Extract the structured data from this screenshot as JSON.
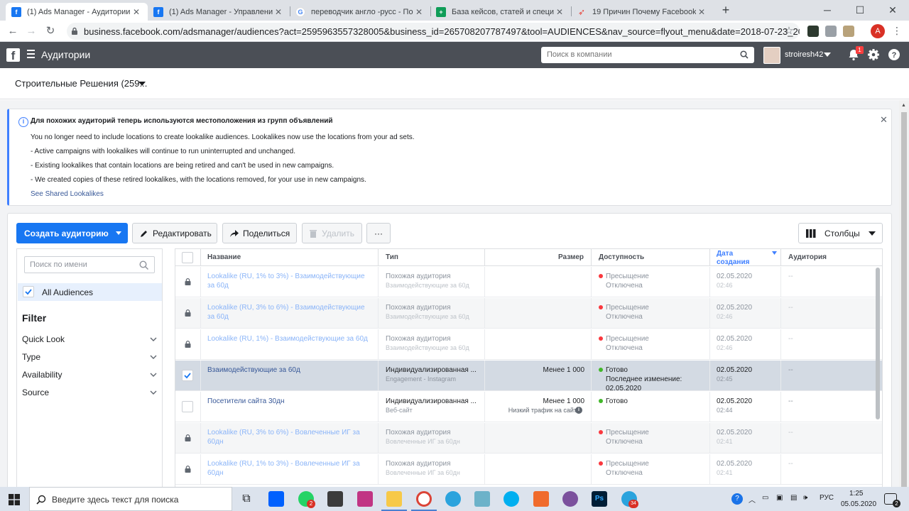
{
  "browser": {
    "tabs": [
      {
        "title": "(1) Ads Manager - Аудитории",
        "active": true
      },
      {
        "title": "(1) Ads Manager - Управление р",
        "active": false
      },
      {
        "title": "переводчик англо -русс - Поис",
        "active": false
      },
      {
        "title": "База кейсов, статей и специали",
        "active": false
      },
      {
        "title": "19 Причин Почему Facebook За",
        "active": false
      }
    ],
    "url": "business.facebook.com/adsmanager/audiences?act=2595963557328005&business_id=265708207787497&tool=AUDIENCES&nav_source=flyout_menu&date=2018-07-23_2020-05-03%2C...",
    "profile_initial": "A"
  },
  "fb": {
    "title": "Аудитории",
    "search_placeholder": "Поиск в компании",
    "username": "stroiresh42",
    "notif_count": "1"
  },
  "account": {
    "name": "Строительные Решения (259..."
  },
  "notice": {
    "title": "Для похожих аудиторий теперь используются местоположения из групп объявлений",
    "lines": [
      "You no longer need to include locations to create lookalike audiences. Lookalikes now use the locations from your ad sets.",
      "- Active campaigns with lookalikes will continue to run uninterrupted and unchanged.",
      "- Existing lookalikes that contain locations are being retired and can't be used in new campaigns.",
      "- We created copies of these retired lookalikes, with the locations removed, for your use in new campaigns."
    ],
    "link": "See Shared Lookalikes"
  },
  "toolbar": {
    "create": "Создать аудиторию",
    "edit": "Редактировать",
    "share": "Поделиться",
    "delete": "Удалить",
    "more": "···",
    "columns": "Столбцы"
  },
  "filter": {
    "search_placeholder": "Поиск по имени",
    "all": "All Audiences",
    "heading": "Filter",
    "items": [
      "Quick Look",
      "Type",
      "Availability",
      "Source"
    ]
  },
  "table": {
    "headers": {
      "name": "Название",
      "type": "Тип",
      "size": "Размер",
      "availability": "Доступность",
      "date": "Дата создания",
      "audience": "Аудитория"
    },
    "rows": [
      {
        "name": "Lookalike (RU, 1% to 3%) - Взаимодействующие за 60д",
        "type": "Похожая аудитория",
        "subtype": "Взаимодействующие за 60д",
        "size": "",
        "size_note": "",
        "status": "Пресыщение",
        "status2": "Отключена",
        "status_color": "#fa383e",
        "date": "02.05.2020",
        "time": "02:46",
        "audience": "--",
        "kind": "locked"
      },
      {
        "name": "Lookalike (RU, 3% to 6%) - Взаимодействующие за 60д",
        "type": "Похожая аудитория",
        "subtype": "Взаимодействующие за 60д",
        "size": "",
        "size_note": "",
        "status": "Пресыщение",
        "status2": "Отключена",
        "status_color": "#fa383e",
        "date": "02.05.2020",
        "time": "02:46",
        "audience": "--",
        "kind": "locked"
      },
      {
        "name": "Lookalike (RU, 1%) - Взаимодействующие за 60д",
        "type": "Похожая аудитория",
        "subtype": "Взаимодействующие за 60д",
        "size": "",
        "size_note": "",
        "status": "Пресыщение",
        "status2": "Отключена",
        "status_color": "#fa383e",
        "date": "02.05.2020",
        "time": "02:46",
        "audience": "--",
        "kind": "locked"
      },
      {
        "name": "Взаимодействующие за 60д",
        "type": "Индивидуализированная ...",
        "subtype": "Engagement - Instagram",
        "size": "Менее 1 000",
        "size_note": "",
        "status": "Готово",
        "status2": "Последнее изменение: 02.05.2020",
        "status_color": "#42b72a",
        "date": "02.05.2020",
        "time": "02:45",
        "audience": "--",
        "kind": "selected"
      },
      {
        "name": "Посетители сайта 30дн",
        "type": "Индивидуализированная ...",
        "subtype": "Веб-сайт",
        "size": "Менее 1 000",
        "size_note": "Низкий трафик на сайт",
        "status": "Готово",
        "status2": "",
        "status_color": "#42b72a",
        "date": "02.05.2020",
        "time": "02:44",
        "audience": "--",
        "kind": "normal"
      },
      {
        "name": "Lookalike (RU, 3% to 6%) - Вовлеченные ИГ за 60дн",
        "type": "Похожая аудитория",
        "subtype": "Вовлеченные ИГ за 60дн",
        "size": "",
        "size_note": "",
        "status": "Пресыщение",
        "status2": "Отключена",
        "status_color": "#fa383e",
        "date": "02.05.2020",
        "time": "02:41",
        "audience": "--",
        "kind": "locked"
      },
      {
        "name": "Lookalike (RU, 1% to 3%) - Вовлеченные ИГ за 60дн",
        "type": "Похожая аудитория",
        "subtype": "Вовлеченные ИГ за 60дн",
        "size": "",
        "size_note": "",
        "status": "Пресыщение",
        "status2": "Отключена",
        "status_color": "#fa383e",
        "date": "02.05.2020",
        "time": "02:41",
        "audience": "--",
        "kind": "locked"
      }
    ]
  },
  "taskbar": {
    "search_placeholder": "Введите здесь текст для поиска",
    "lang": "РУС",
    "time": "1:25",
    "date": "05.05.2020",
    "badge_whatsapp": "2",
    "badge_telegram": "34",
    "notif_count": "2"
  },
  "colors": {
    "fb_blue": "#1877f2",
    "fb_bar": "#4b4f56",
    "link": "#385898",
    "notice_accent": "#4080ff"
  }
}
